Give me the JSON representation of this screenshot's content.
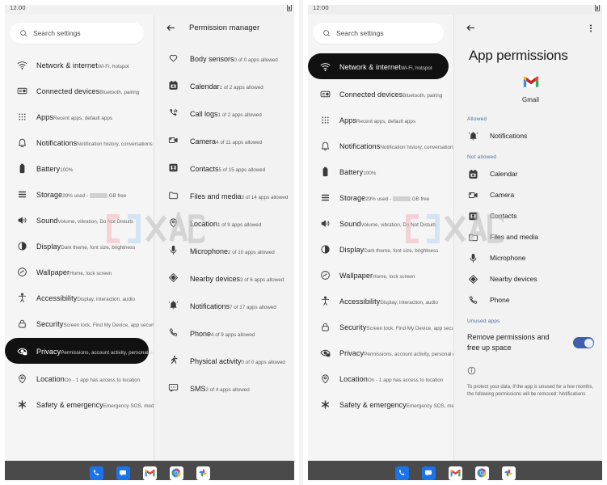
{
  "status_bar": {
    "time": "12:00",
    "battery_icon": "battery-icon"
  },
  "search": {
    "placeholder": "Search settings",
    "icon": "search-icon"
  },
  "settings_list": [
    {
      "icon": "wifi-icon",
      "title": "Network & internet",
      "subtitle": "Wi-Fi, hotspot"
    },
    {
      "icon": "devices-icon",
      "title": "Connected devices",
      "subtitle": "Bluetooth, pairing"
    },
    {
      "icon": "apps-grid-icon",
      "title": "Apps",
      "subtitle": "Recent apps, default apps"
    },
    {
      "icon": "bell-icon",
      "title": "Notifications",
      "subtitle": "Notification history, conversations"
    },
    {
      "icon": "battery-icon",
      "title": "Battery",
      "subtitle": "100%"
    },
    {
      "icon": "storage-icon",
      "title": "Storage",
      "subtitle": "29% used - ",
      "subtitle_redacted": true,
      "subtitle_tail": "GB free"
    },
    {
      "icon": "sound-icon",
      "title": "Sound",
      "subtitle": "Volume, vibration, Do Not Disturb"
    },
    {
      "icon": "display-icon",
      "title": "Display",
      "subtitle": "Dark theme, font size, brightness"
    },
    {
      "icon": "wallpaper-icon",
      "title": "Wallpaper",
      "subtitle": "Home, lock screen"
    },
    {
      "icon": "accessibility-icon",
      "title": "Accessibility",
      "subtitle": "Display, interaction, audio"
    },
    {
      "icon": "lock-icon",
      "title": "Security",
      "subtitle": "Screen lock, Find My Device, app security"
    },
    {
      "icon": "privacy-icon",
      "title": "Privacy",
      "subtitle": "Permissions, account activity, personal data"
    },
    {
      "icon": "location-icon",
      "title": "Location",
      "subtitle": "On - 1 app has access to location"
    },
    {
      "icon": "safety-icon",
      "title": "Safety & emergency",
      "subtitle": "Emergency SOS, medical info, alerts"
    }
  ],
  "left_device": {
    "selected_setting_index": 11,
    "detail": {
      "back_icon": "back-arrow-icon",
      "title": "Permission manager",
      "permissions": [
        {
          "icon": "heart-icon",
          "name": "Body sensors",
          "status": "0 of 0 apps allowed"
        },
        {
          "icon": "calendar-icon",
          "name": "Calendar",
          "status": "1 of 2 apps allowed"
        },
        {
          "icon": "call-log-icon",
          "name": "Call logs",
          "status": "1 of 2 apps allowed"
        },
        {
          "icon": "camera-icon",
          "name": "Camera",
          "status": "4 of 11 apps allowed"
        },
        {
          "icon": "contacts-icon",
          "name": "Contacts",
          "status": "5 of 15 apps allowed"
        },
        {
          "icon": "folder-icon",
          "name": "Files and media",
          "status": "3 of 14 apps allowed"
        },
        {
          "icon": "location-icon",
          "name": "Location",
          "status": "1 of 9 apps allowed"
        },
        {
          "icon": "microphone-icon",
          "name": "Microphone",
          "status": "2 of 10 apps allowed"
        },
        {
          "icon": "nearby-icon",
          "name": "Nearby devices",
          "status": "3 of 6 apps allowed"
        },
        {
          "icon": "notifications-icon",
          "name": "Notifications",
          "status": "7 of 17 apps allowed"
        },
        {
          "icon": "phone-icon",
          "name": "Phone",
          "status": "4 of 9 apps allowed"
        },
        {
          "icon": "running-icon",
          "name": "Physical activity",
          "status": "0 of 0 apps allowed"
        },
        {
          "icon": "sms-icon",
          "name": "SMS",
          "status": "2 of 4 apps allowed"
        }
      ]
    }
  },
  "right_device": {
    "selected_setting_index": 0,
    "detail": {
      "back_icon": "back-arrow-icon",
      "overflow_icon": "more-vert-icon",
      "title": "App permissions",
      "app": {
        "icon": "gmail-icon",
        "name": "Gmail"
      },
      "sections": [
        {
          "label": "Allowed",
          "items": [
            {
              "icon": "notifications-icon",
              "name": "Notifications"
            }
          ]
        },
        {
          "label": "Not allowed",
          "items": [
            {
              "icon": "calendar-icon",
              "name": "Calendar"
            },
            {
              "icon": "camera-icon",
              "name": "Camera"
            },
            {
              "icon": "contacts-icon",
              "name": "Contacts"
            },
            {
              "icon": "folder-icon",
              "name": "Files and media"
            },
            {
              "icon": "microphone-icon",
              "name": "Microphone"
            },
            {
              "icon": "nearby-icon",
              "name": "Nearby devices"
            },
            {
              "icon": "phone-icon",
              "name": "Phone"
            }
          ]
        }
      ],
      "unused_apps": {
        "label": "Unused apps",
        "toggle_label": "Remove permissions and free up space",
        "toggle_on": true,
        "info_icon": "info-icon",
        "note": "To protect your data, if the app is unused for a few months, the following permissions will be removed: Notifications"
      }
    }
  },
  "taskbar": {
    "apps": [
      {
        "name": "Phone",
        "icon": "phone-app-icon"
      },
      {
        "name": "Messages",
        "icon": "messages-app-icon"
      },
      {
        "name": "Gmail",
        "icon": "gmail-app-icon"
      },
      {
        "name": "Chrome",
        "icon": "chrome-app-icon"
      },
      {
        "name": "Photos",
        "icon": "photos-app-icon"
      }
    ]
  },
  "watermark": {
    "text": "XDA"
  },
  "colors": {
    "selected_bg": "#111111",
    "accent_blue": "#4a6fa5",
    "toggle_on": "#3f5fa8",
    "taskbar_bg": "#4a4a4a",
    "pane_bg": "#f5f5f5"
  }
}
